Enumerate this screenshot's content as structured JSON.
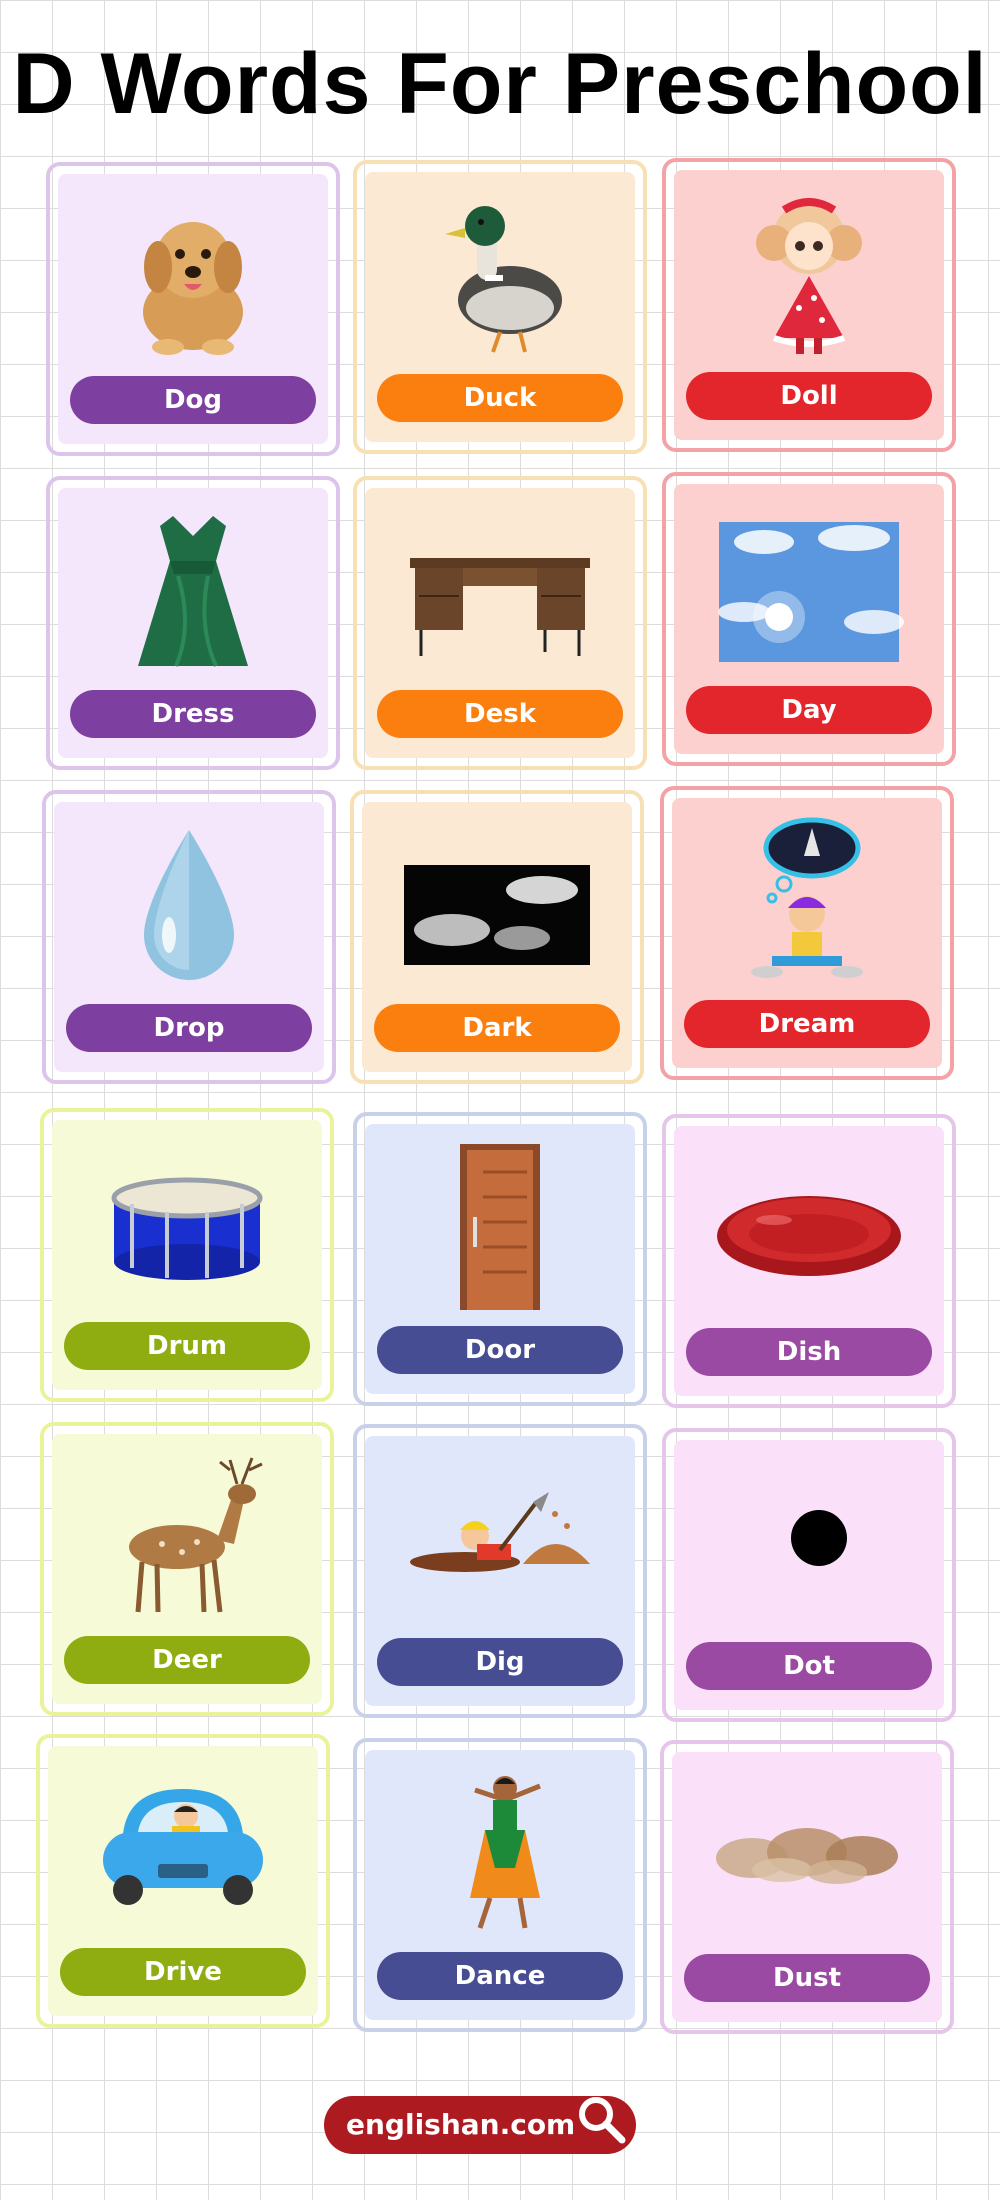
{
  "title": "D Words For Preschool",
  "cards": [
    {
      "word": "Dog",
      "icon": "dog-icon",
      "theme": "purple"
    },
    {
      "word": "Duck",
      "icon": "duck-icon",
      "theme": "orange"
    },
    {
      "word": "Doll",
      "icon": "doll-icon",
      "theme": "red"
    },
    {
      "word": "Dress",
      "icon": "dress-icon",
      "theme": "purple"
    },
    {
      "word": "Desk",
      "icon": "desk-icon",
      "theme": "orange"
    },
    {
      "word": "Day",
      "icon": "day-sky-icon",
      "theme": "red"
    },
    {
      "word": "Drop",
      "icon": "water-drop-icon",
      "theme": "purple"
    },
    {
      "word": "Dark",
      "icon": "dark-clouds-icon",
      "theme": "orange"
    },
    {
      "word": "Dream",
      "icon": "dream-icon",
      "theme": "red"
    },
    {
      "word": "Drum",
      "icon": "drum-icon",
      "theme": "green"
    },
    {
      "word": "Door",
      "icon": "door-icon",
      "theme": "blue"
    },
    {
      "word": "Dish",
      "icon": "dish-icon",
      "theme": "pink"
    },
    {
      "word": "Deer",
      "icon": "deer-icon",
      "theme": "green"
    },
    {
      "word": "Dig",
      "icon": "dig-icon",
      "theme": "blue"
    },
    {
      "word": "Dot",
      "icon": "dot-icon",
      "theme": "pink"
    },
    {
      "word": "Drive",
      "icon": "car-icon",
      "theme": "green"
    },
    {
      "word": "Dance",
      "icon": "dancer-icon",
      "theme": "blue"
    },
    {
      "word": "Dust",
      "icon": "dust-icon",
      "theme": "pink"
    }
  ],
  "colors": {
    "purple": "#7d3fa0",
    "orange": "#fb7f0f",
    "red": "#e3262c",
    "green": "#8fac11",
    "blue": "#474d92",
    "pink": "#9a4aa3",
    "footer": "#ad1a20"
  },
  "footer": {
    "site": "englishan.com",
    "icon": "search-icon"
  }
}
